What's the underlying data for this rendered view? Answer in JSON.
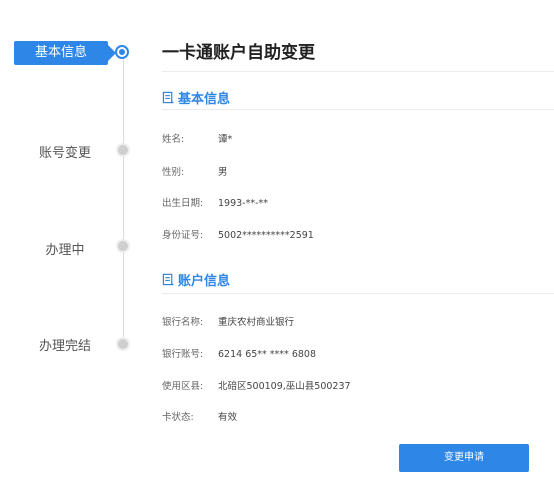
{
  "steps": [
    {
      "label": "基本信息"
    },
    {
      "label": "账号变更"
    },
    {
      "label": "办理中"
    },
    {
      "label": "办理完结"
    }
  ],
  "page": {
    "title": "一卡通账户自助变更"
  },
  "basic": {
    "heading": "基本信息",
    "fields": [
      {
        "key": "姓名:",
        "value": "谭*"
      },
      {
        "key": "性别:",
        "value": "男"
      },
      {
        "key": "出生日期:",
        "value": "1993-**-**"
      },
      {
        "key": "身份证号:",
        "value": "5002**********2591"
      }
    ]
  },
  "account": {
    "heading": "账户信息",
    "fields": [
      {
        "key": "银行名称:",
        "value": "重庆农村商业银行"
      },
      {
        "key": "银行账号:",
        "value": "6214 65** **** 6808"
      },
      {
        "key": "使用区县:",
        "value": "北碚区500109,巫山县500237"
      },
      {
        "key": "卡状态:",
        "value": "有效"
      }
    ]
  },
  "actions": {
    "submit_label": "变更申请"
  },
  "colors": {
    "accent": "#2e86e6",
    "inactive_dot": "#cfcfcf"
  },
  "icons": {
    "section": "form-icon"
  }
}
